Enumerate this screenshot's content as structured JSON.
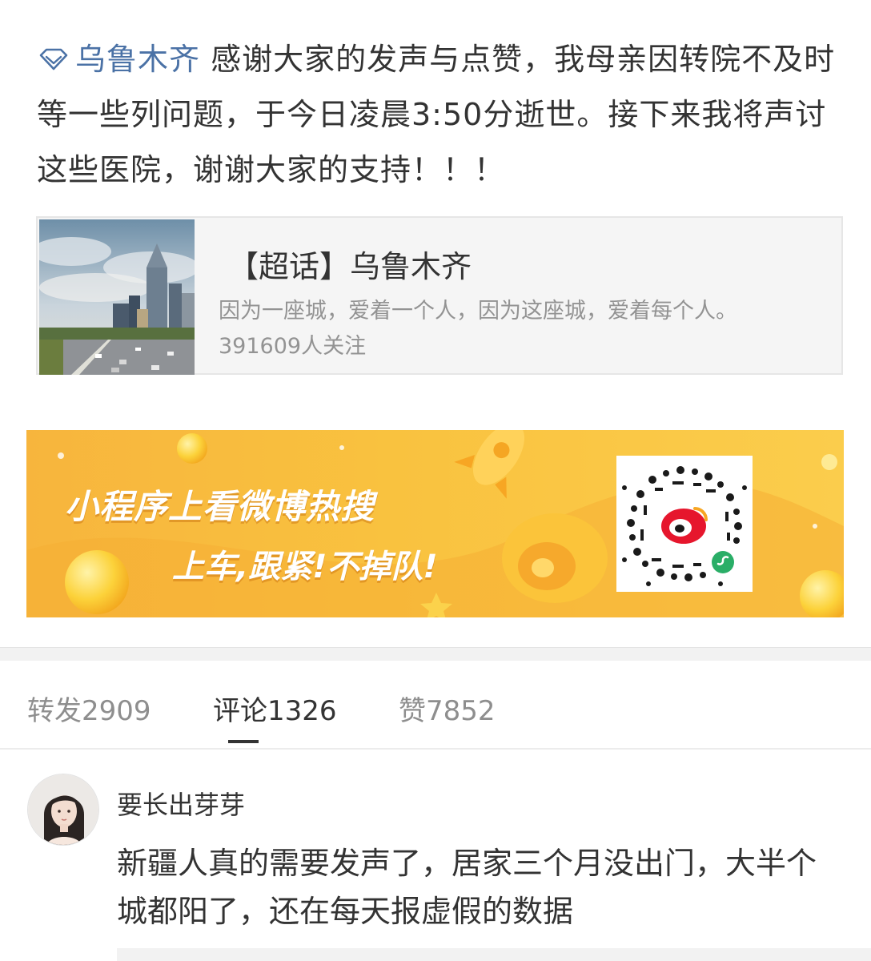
{
  "post": {
    "topic_name": "乌鲁木齐",
    "text": "感谢大家的发声与点赞，我母亲因转院不及时等一些列问题，于今日凌晨3:50分逝世。接下来我将声讨这些医院，谢谢大家的支持！！！"
  },
  "topic_card": {
    "title": "【超话】乌鲁木齐",
    "description": "因为一座城，爱着一个人，因为这座城，爱着每个人。",
    "followers": "391609人关注"
  },
  "banner": {
    "line1": "小程序上看微博热搜",
    "line2": "上车,跟紧!不掉队!"
  },
  "tabs": {
    "repost": "转发2909",
    "comments": "评论1326",
    "likes": "赞7852",
    "active": "comments"
  },
  "comment": {
    "author": "要长出芽芽",
    "text": "新疆人真的需要发声了，居家三个月没出门，大半个城都阳了，还在每天报虚假的数据"
  },
  "colors": {
    "link": "#4b72a6",
    "text": "#333333",
    "muted": "#939393",
    "banner": "#f9c23f"
  },
  "icons": {
    "topic": "super-topic-diamond-icon",
    "qr": "weibo-qr-code"
  }
}
